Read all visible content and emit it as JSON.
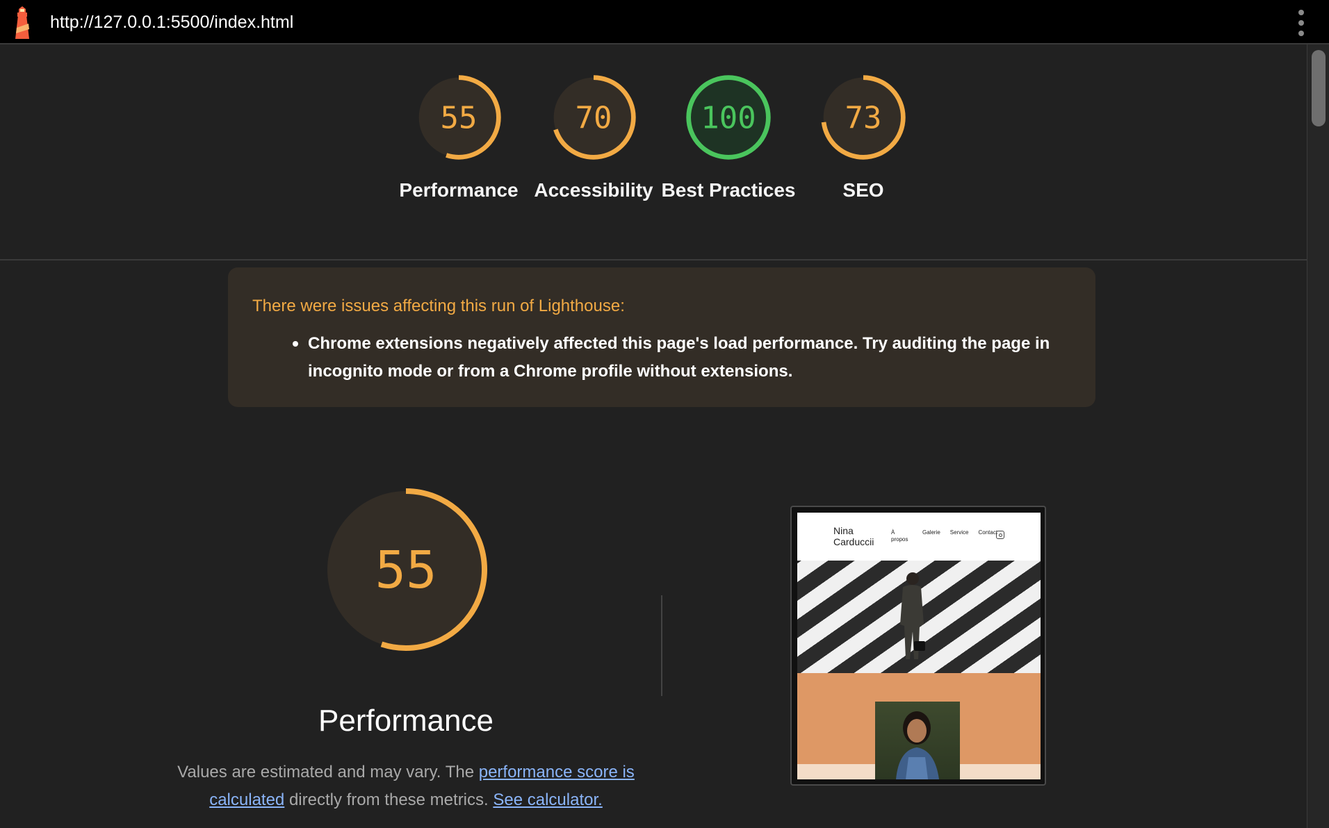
{
  "topbar": {
    "url": "http://127.0.0.1:5500/index.html",
    "logo_icon": "lighthouse-icon",
    "menu_icon": "more-vert-icon"
  },
  "gauges": [
    {
      "label": "Performance",
      "score": "55",
      "value": 55,
      "status": "average"
    },
    {
      "label": "Accessibility",
      "score": "70",
      "value": 70,
      "status": "average"
    },
    {
      "label": "Best Practices",
      "score": "100",
      "value": 100,
      "status": "pass"
    },
    {
      "label": "SEO",
      "score": "73",
      "value": 73,
      "status": "average"
    }
  ],
  "colors": {
    "average": "#f2aa44",
    "average_bg": "#332d26",
    "pass": "#0cce6b",
    "pass_ring": "#4ac55d",
    "pass_bg": "#1e3324",
    "link": "#8ab4f8"
  },
  "warning": {
    "title": "There were issues affecting this run of Lighthouse:",
    "items": [
      "Chrome extensions negatively affected this page's load performance. Try auditing the page in incognito mode or from a Chrome profile without extensions."
    ]
  },
  "performance": {
    "score": "55",
    "value": 55,
    "title": "Performance",
    "desc_prefix": "Values are estimated and may vary. The ",
    "link1": "performance score is calculated",
    "desc_middle": " directly from these metrics. ",
    "link2": "See calculator."
  },
  "thumbnail": {
    "site_name_line1": "Nina",
    "site_name_line2": "Carduccii",
    "nav": [
      "À propos",
      "Galerie",
      "Service",
      "Contact"
    ],
    "ig_icon": "instagram-icon"
  }
}
